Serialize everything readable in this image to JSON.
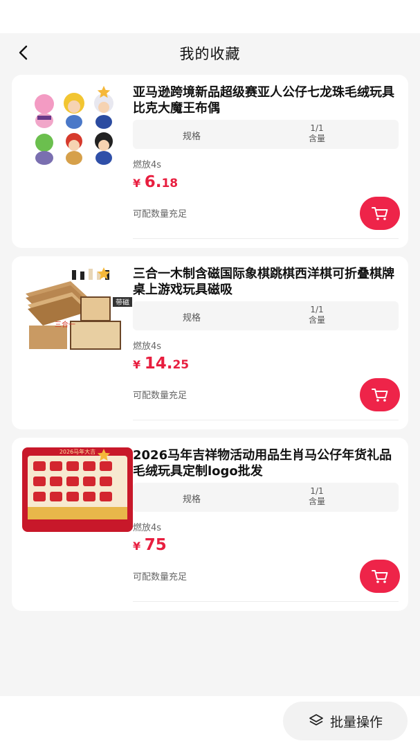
{
  "header": {
    "title": "我的收藏"
  },
  "colors": {
    "accent": "#e81e3f",
    "cart_button": "#ee2449",
    "background": "#f5f5f5"
  },
  "items": [
    {
      "title": "亚马逊跨境新品超级赛亚人公仔七龙珠毛绒玩具比克大魔王布偶",
      "spec_label": "规格",
      "spec_value": "1/1",
      "spec_unit": "含量",
      "burn": "燃放4s",
      "currency": "¥",
      "price_int": "6.",
      "price_dec": "18",
      "stock": "可配数量充足",
      "image": "plush-dolls-image"
    },
    {
      "title": "三合一木制含磁国际象棋跳棋西洋棋可折叠棋牌桌上游戏玩具磁吸",
      "spec_label": "规格",
      "spec_value": "1/1",
      "spec_unit": "含量",
      "burn": "燃放4s",
      "currency": "¥",
      "price_int": "14.",
      "price_dec": "25",
      "stock": "可配数量充足",
      "image": "chess-board-image",
      "image_text": [
        "带磁",
        "三合一"
      ]
    },
    {
      "title": "2026马年吉祥物活动用品生肖马公仔年货礼品毛绒玩具定制logo批发",
      "spec_label": "规格",
      "spec_value": "1/1",
      "spec_unit": "含量",
      "burn": "燃放4s",
      "currency": "¥",
      "price_int": "75",
      "price_dec": "",
      "stock": "可配数量充足",
      "image": "horse-plush-image",
      "image_text": [
        "2026马年大吉"
      ]
    }
  ],
  "footer": {
    "batch_label": "批量操作"
  }
}
